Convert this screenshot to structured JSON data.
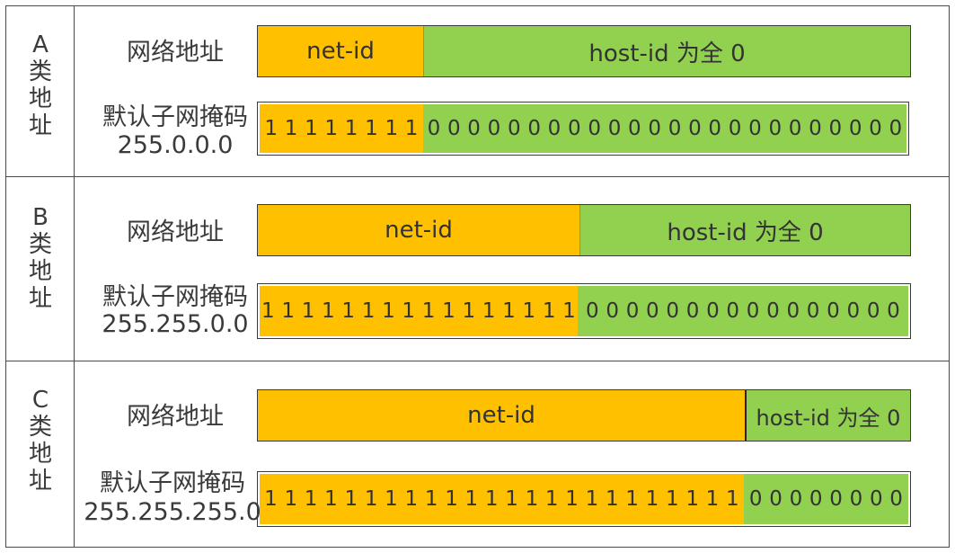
{
  "colors": {
    "net": "#ffc000",
    "host": "#92d050",
    "border": "#4a4a4a"
  },
  "rows": [
    {
      "class_chars": [
        "A",
        "类",
        "地",
        "址"
      ],
      "addr_label": "网络地址",
      "mask_label": "默认子网掩码",
      "mask_value": "255.0.0.0",
      "net_text": "net-id",
      "host_text": "host-id 为全 0",
      "mask_net_bits": "1 1 1 1 1 1 1 1",
      "mask_host_bits": "0 0 0 0 0 0 0 0 0 0 0 0 0 0 0 0 0 0 0 0 0 0 0 0"
    },
    {
      "class_chars": [
        "B",
        "类",
        "地",
        "址"
      ],
      "addr_label": "网络地址",
      "mask_label": "默认子网掩码",
      "mask_value": "255.255.0.0",
      "net_text": "net-id",
      "host_text": "host-id 为全 0",
      "mask_net_bits": "1 1 1 1 1 1 1 1 1 1 1 1 1 1 1 1",
      "mask_host_bits": "0 0 0 0 0 0 0 0 0 0 0 0 0 0 0 0"
    },
    {
      "class_chars": [
        "C",
        "类",
        "地",
        "址"
      ],
      "addr_label": "网络地址",
      "mask_label": "默认子网掩码",
      "mask_value": "255.255.255.0",
      "net_text": "net-id",
      "host_text": "host-id 为全 0",
      "mask_net_bits": "1 1 1 1 1 1 1 1 1 1 1 1 1 1 1 1 1 1 1 1 1 1 1 1",
      "mask_host_bits": "0 0 0 0 0 0 0 0"
    }
  ]
}
